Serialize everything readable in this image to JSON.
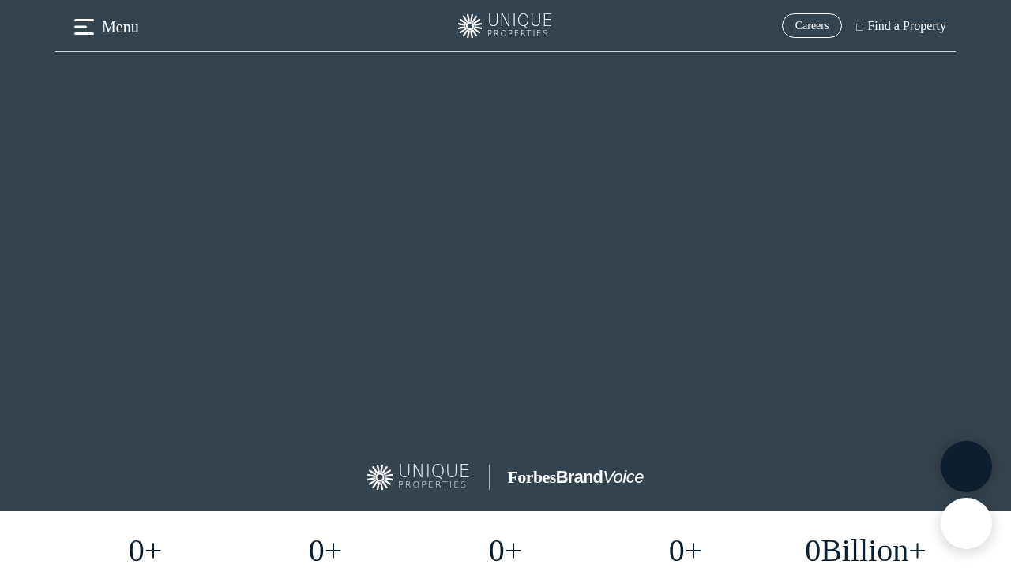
{
  "header": {
    "menu_label": "Menu",
    "logo": {
      "line_1": "UNIQUE",
      "line_2": "PROPERTIES"
    },
    "careers_button": "Careers",
    "find_property_link": "Find a Property"
  },
  "hero": {
    "brand_logo": {
      "line_1": "UNIQUE",
      "line_2": "PROPERTIES"
    },
    "partner_logo": {
      "parts": [
        "Forbes",
        "Brand",
        "Voice"
      ]
    }
  },
  "floating_buttons": [
    {
      "kind": "dark"
    },
    {
      "kind": "light"
    }
  ],
  "stats": [
    {
      "value": "0+"
    },
    {
      "value": "0+"
    },
    {
      "value": "0+"
    },
    {
      "value": "0+"
    },
    {
      "value": "0Billion+"
    }
  ]
}
